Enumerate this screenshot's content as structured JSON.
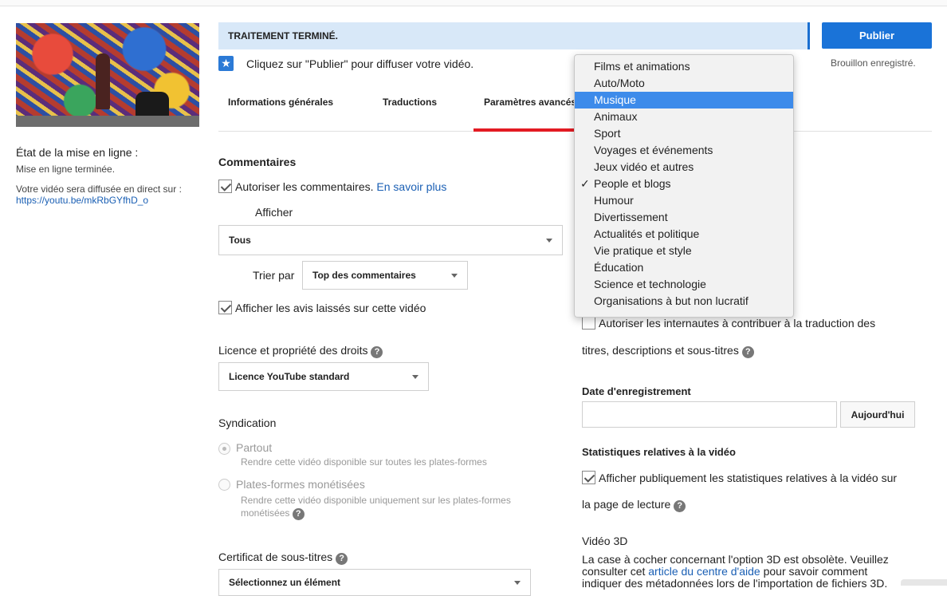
{
  "sidebar": {
    "status_title": "État de la mise en ligne :",
    "status_line": "Mise en ligne terminée.",
    "live_text": "Votre vidéo sera diffusée en direct sur : ",
    "live_url": "https://youtu.be/mkRbGYfhD_o"
  },
  "header": {
    "processing": "TRAITEMENT TERMINÉ.",
    "publish_label": "Publier",
    "draft_status": "Brouillon enregistré.",
    "publish_hint": "Cliquez sur \"Publier\" pour diffuser votre vidéo."
  },
  "tabs": [
    {
      "label": "Informations générales"
    },
    {
      "label": "Traductions"
    },
    {
      "label": "Paramètres avancés"
    }
  ],
  "comments": {
    "heading": "Commentaires",
    "allow_label": "Autoriser les commentaires.",
    "learn_more": "En savoir plus",
    "show_label": "Afficher",
    "show_value": "Tous",
    "sort_label": "Trier par",
    "sort_value": "Top des commentaires",
    "ratings_label": "Afficher les avis laissés sur cette vidéo"
  },
  "license": {
    "heading": "Licence et propriété des droits",
    "value": "Licence YouTube standard"
  },
  "syndication": {
    "heading": "Syndication",
    "opt1_label": "Partout",
    "opt1_desc": "Rendre cette vidéo disponible sur toutes les plates-formes",
    "opt2_label": "Plates-formes monétisées",
    "opt2_desc": "Rendre cette vidéo disponible uniquement sur les plates-formes monétisées"
  },
  "subtitles": {
    "heading": "Certificat de sous-titres",
    "value": "Sélectionnez un élément"
  },
  "translations": {
    "contrib_line1": "Autoriser les internautes à contribuer à la traduction des",
    "contrib_line2": "titres, descriptions et sous-titres"
  },
  "recording": {
    "heading": "Date d'enregistrement",
    "date_value": "",
    "today_label": "Aujourd'hui"
  },
  "stats": {
    "heading": "Statistiques relatives à la vidéo",
    "line1": "Afficher publiquement les statistiques relatives à la vidéo sur",
    "line2": "la page de lecture"
  },
  "video3d": {
    "heading": "Vidéo 3D",
    "line1": "La case à cocher concernant l'option 3D est obsolète. Veuillez",
    "line2_pre": "consulter cet ",
    "line2_link": "article du centre d'aide",
    "line2_post": " pour savoir comment",
    "line3": "indiquer des métadonnées lors de l'importation de fichiers 3D."
  },
  "category_dropdown": {
    "highlighted": "Musique",
    "selected": "People et blogs",
    "options": [
      "Films et animations",
      "Auto/Moto",
      "Musique",
      "Animaux",
      "Sport",
      "Voyages et événements",
      "Jeux vidéo et autres",
      "People et blogs",
      "Humour",
      "Divertissement",
      "Actualités et politique",
      "Vie pratique et style",
      "Éducation",
      "Science et technologie",
      "Organisations à but non lucratif"
    ]
  },
  "colors": {
    "accent": "#1a73d8",
    "processing_bg": "#d8e8f8",
    "tab_active": "#e31b23",
    "highlight": "#3d8bea"
  }
}
